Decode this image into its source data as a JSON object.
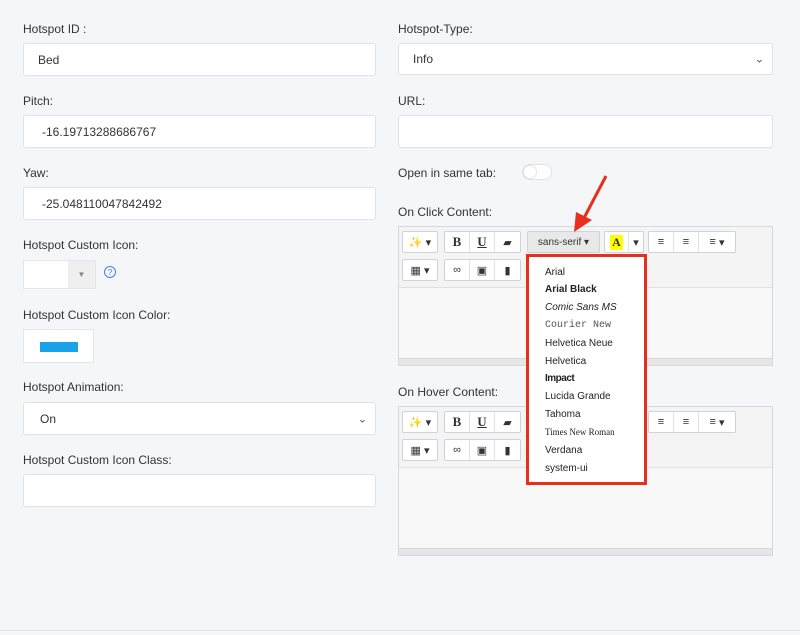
{
  "left": {
    "hotspot_id": {
      "label": "Hotspot ID :",
      "value": "Bed"
    },
    "pitch": {
      "label": "Pitch:",
      "value": "-16.19713288686767"
    },
    "yaw": {
      "label": "Yaw:",
      "value": "-25.048110047842492"
    },
    "custom_icon": {
      "label": "Hotspot Custom Icon:",
      "help": "?"
    },
    "icon_color": {
      "label": "Hotspot Custom Icon Color:",
      "swatch": "#1aa3e8"
    },
    "animation": {
      "label": "Hotspot Animation:",
      "value": "On"
    },
    "icon_class": {
      "label": "Hotspot Custom Icon Class:",
      "value": ""
    }
  },
  "right": {
    "hotspot_type": {
      "label": "Hotspot-Type:",
      "value": "Info"
    },
    "url": {
      "label": "URL:",
      "value": ""
    },
    "same_tab": {
      "label": "Open in same tab:"
    },
    "click_content": {
      "label": "On Click Content:"
    },
    "hover_content": {
      "label": "On Hover Content:"
    }
  },
  "toolbar": {
    "magic": "✨",
    "bold": "B",
    "underline": "U",
    "font_name": "sans-serif",
    "color_letter": "A",
    "caret": "▾"
  },
  "font_menu": {
    "items": [
      "Arial",
      "Arial Black",
      "Comic Sans MS",
      "Courier New",
      "Helvetica Neue",
      "Helvetica",
      "Impact",
      "Lucida Grande",
      "Tahoma",
      "Times New Roman",
      "Verdana",
      "system-ui"
    ]
  },
  "colors": {
    "highlight": "#e7301c",
    "accent_yellow": "#ffff00"
  }
}
